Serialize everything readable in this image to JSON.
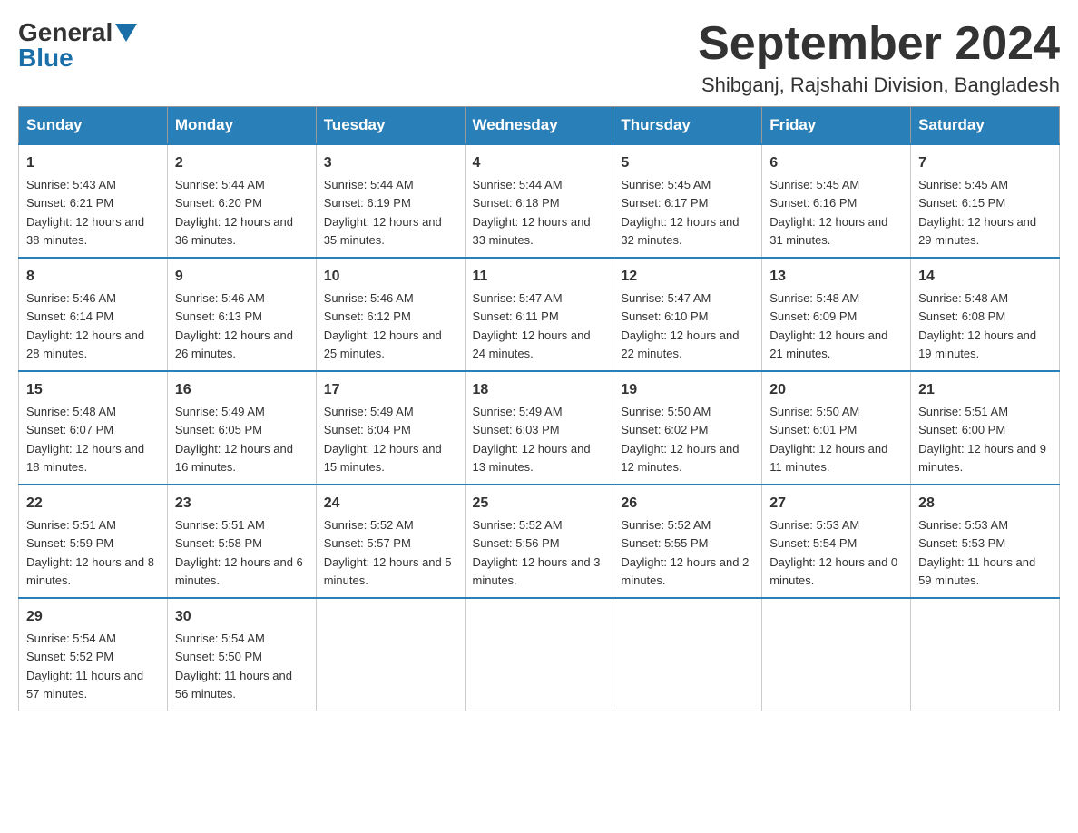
{
  "header": {
    "logo_general": "General",
    "logo_blue": "Blue",
    "title": "September 2024",
    "subtitle": "Shibganj, Rajshahi Division, Bangladesh"
  },
  "weekdays": [
    "Sunday",
    "Monday",
    "Tuesday",
    "Wednesday",
    "Thursday",
    "Friday",
    "Saturday"
  ],
  "weeks": [
    [
      {
        "day": "1",
        "sunrise": "5:43 AM",
        "sunset": "6:21 PM",
        "daylight": "12 hours and 38 minutes."
      },
      {
        "day": "2",
        "sunrise": "5:44 AM",
        "sunset": "6:20 PM",
        "daylight": "12 hours and 36 minutes."
      },
      {
        "day": "3",
        "sunrise": "5:44 AM",
        "sunset": "6:19 PM",
        "daylight": "12 hours and 35 minutes."
      },
      {
        "day": "4",
        "sunrise": "5:44 AM",
        "sunset": "6:18 PM",
        "daylight": "12 hours and 33 minutes."
      },
      {
        "day": "5",
        "sunrise": "5:45 AM",
        "sunset": "6:17 PM",
        "daylight": "12 hours and 32 minutes."
      },
      {
        "day": "6",
        "sunrise": "5:45 AM",
        "sunset": "6:16 PM",
        "daylight": "12 hours and 31 minutes."
      },
      {
        "day": "7",
        "sunrise": "5:45 AM",
        "sunset": "6:15 PM",
        "daylight": "12 hours and 29 minutes."
      }
    ],
    [
      {
        "day": "8",
        "sunrise": "5:46 AM",
        "sunset": "6:14 PM",
        "daylight": "12 hours and 28 minutes."
      },
      {
        "day": "9",
        "sunrise": "5:46 AM",
        "sunset": "6:13 PM",
        "daylight": "12 hours and 26 minutes."
      },
      {
        "day": "10",
        "sunrise": "5:46 AM",
        "sunset": "6:12 PM",
        "daylight": "12 hours and 25 minutes."
      },
      {
        "day": "11",
        "sunrise": "5:47 AM",
        "sunset": "6:11 PM",
        "daylight": "12 hours and 24 minutes."
      },
      {
        "day": "12",
        "sunrise": "5:47 AM",
        "sunset": "6:10 PM",
        "daylight": "12 hours and 22 minutes."
      },
      {
        "day": "13",
        "sunrise": "5:48 AM",
        "sunset": "6:09 PM",
        "daylight": "12 hours and 21 minutes."
      },
      {
        "day": "14",
        "sunrise": "5:48 AM",
        "sunset": "6:08 PM",
        "daylight": "12 hours and 19 minutes."
      }
    ],
    [
      {
        "day": "15",
        "sunrise": "5:48 AM",
        "sunset": "6:07 PM",
        "daylight": "12 hours and 18 minutes."
      },
      {
        "day": "16",
        "sunrise": "5:49 AM",
        "sunset": "6:05 PM",
        "daylight": "12 hours and 16 minutes."
      },
      {
        "day": "17",
        "sunrise": "5:49 AM",
        "sunset": "6:04 PM",
        "daylight": "12 hours and 15 minutes."
      },
      {
        "day": "18",
        "sunrise": "5:49 AM",
        "sunset": "6:03 PM",
        "daylight": "12 hours and 13 minutes."
      },
      {
        "day": "19",
        "sunrise": "5:50 AM",
        "sunset": "6:02 PM",
        "daylight": "12 hours and 12 minutes."
      },
      {
        "day": "20",
        "sunrise": "5:50 AM",
        "sunset": "6:01 PM",
        "daylight": "12 hours and 11 minutes."
      },
      {
        "day": "21",
        "sunrise": "5:51 AM",
        "sunset": "6:00 PM",
        "daylight": "12 hours and 9 minutes."
      }
    ],
    [
      {
        "day": "22",
        "sunrise": "5:51 AM",
        "sunset": "5:59 PM",
        "daylight": "12 hours and 8 minutes."
      },
      {
        "day": "23",
        "sunrise": "5:51 AM",
        "sunset": "5:58 PM",
        "daylight": "12 hours and 6 minutes."
      },
      {
        "day": "24",
        "sunrise": "5:52 AM",
        "sunset": "5:57 PM",
        "daylight": "12 hours and 5 minutes."
      },
      {
        "day": "25",
        "sunrise": "5:52 AM",
        "sunset": "5:56 PM",
        "daylight": "12 hours and 3 minutes."
      },
      {
        "day": "26",
        "sunrise": "5:52 AM",
        "sunset": "5:55 PM",
        "daylight": "12 hours and 2 minutes."
      },
      {
        "day": "27",
        "sunrise": "5:53 AM",
        "sunset": "5:54 PM",
        "daylight": "12 hours and 0 minutes."
      },
      {
        "day": "28",
        "sunrise": "5:53 AM",
        "sunset": "5:53 PM",
        "daylight": "11 hours and 59 minutes."
      }
    ],
    [
      {
        "day": "29",
        "sunrise": "5:54 AM",
        "sunset": "5:52 PM",
        "daylight": "11 hours and 57 minutes."
      },
      {
        "day": "30",
        "sunrise": "5:54 AM",
        "sunset": "5:50 PM",
        "daylight": "11 hours and 56 minutes."
      },
      null,
      null,
      null,
      null,
      null
    ]
  ]
}
